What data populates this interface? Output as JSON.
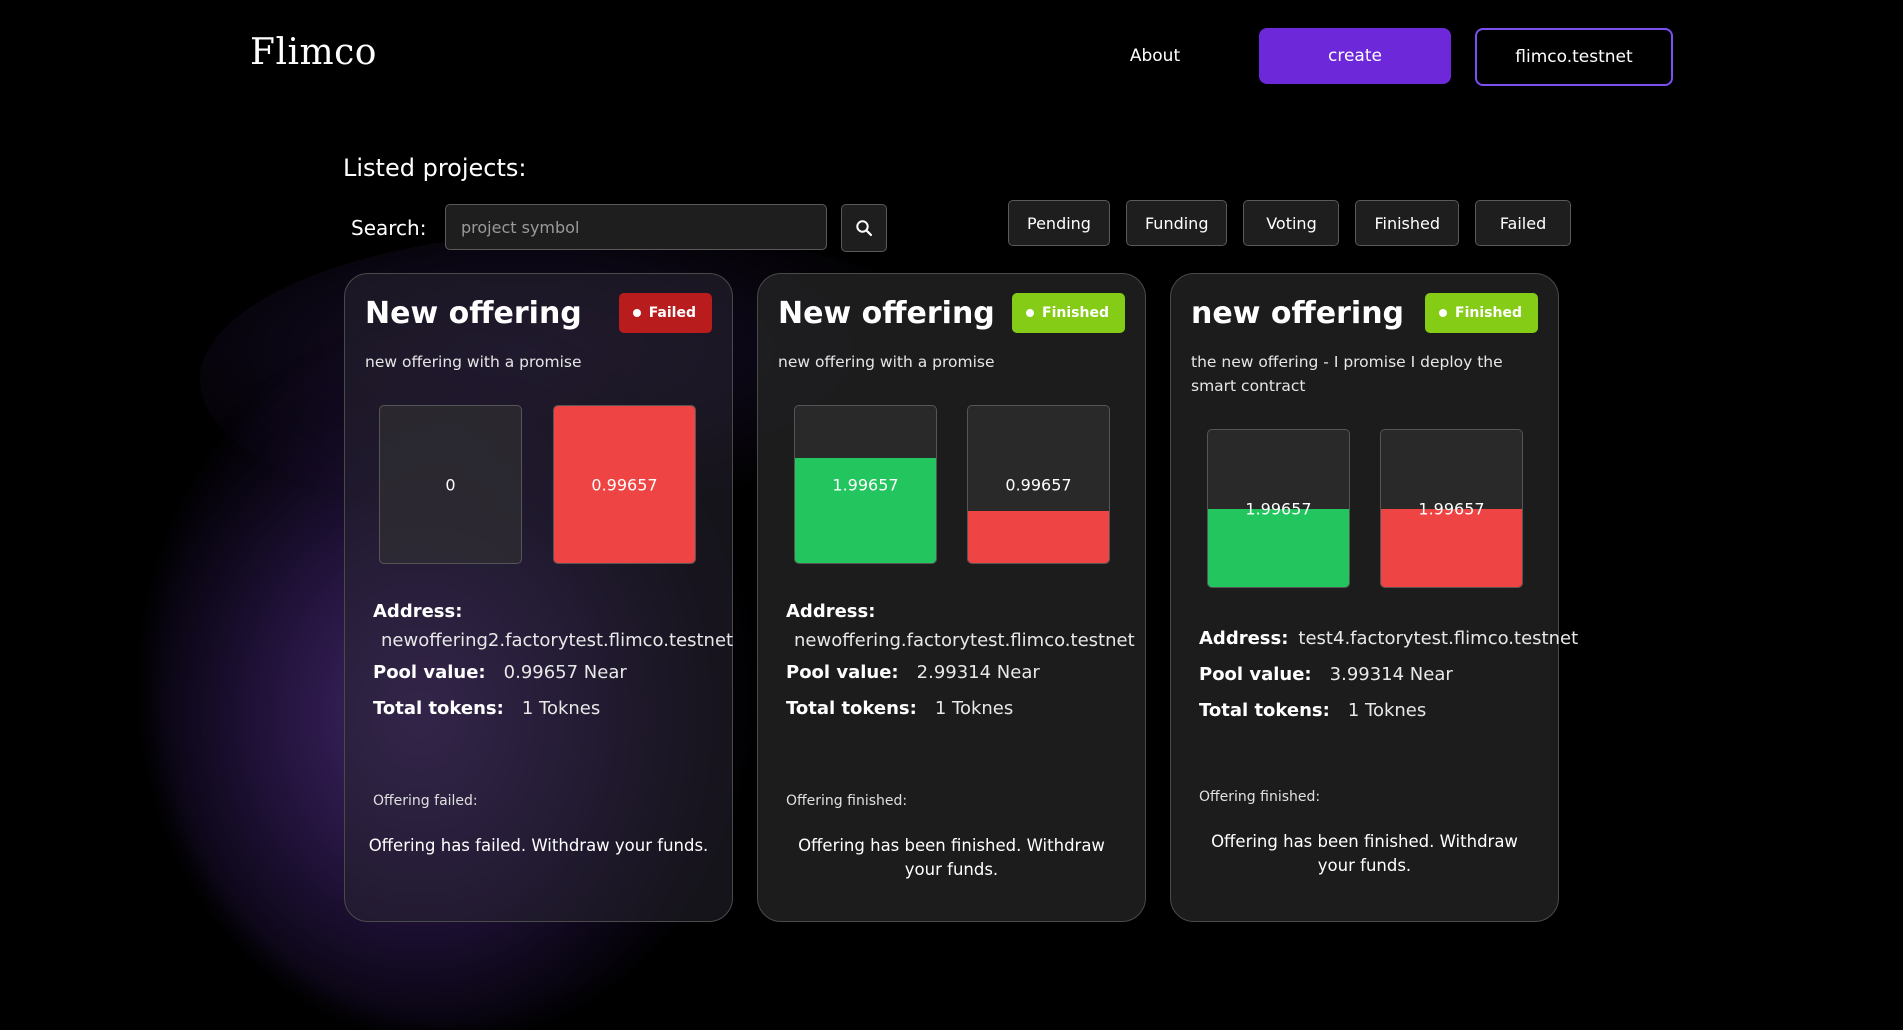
{
  "header": {
    "logo": "Flimco",
    "about": "About",
    "create": "create",
    "account": "flimco.testnet"
  },
  "listing": {
    "title": "Listed projects:",
    "search_label": "Search:",
    "search_placeholder": "project symbol",
    "filters": [
      "Pending",
      "Funding",
      "Voting",
      "Finished",
      "Failed"
    ]
  },
  "colors": {
    "accent": "#6d28d9",
    "failed": "#b91c1c",
    "finished": "#84cc16",
    "yes": "#22c55e",
    "no": "#ef4444"
  },
  "cards": [
    {
      "title": "New offering",
      "status": "Failed",
      "description": "new offering with a promise",
      "bars": [
        {
          "value": "0",
          "fill_fraction": 0.0
        },
        {
          "value": "0.99657",
          "fill_fraction": 1.0
        }
      ],
      "address_label": "Address:",
      "address": "newoffering2.factorytest.flimco.testnet",
      "pool_label": "Pool value:",
      "pool": "0.99657 Near",
      "tokens_label": "Total tokens:",
      "tokens": "1 Toknes",
      "footer_label": "Offering failed:",
      "footer_msg": "Offering has failed. Withdraw your funds."
    },
    {
      "title": "New offering",
      "status": "Finished",
      "description": "new offering with a promise",
      "bars": [
        {
          "value": "1.99657",
          "fill_fraction": 0.67
        },
        {
          "value": "0.99657",
          "fill_fraction": 0.33
        }
      ],
      "address_label": "Address:",
      "address": "newoffering.factorytest.flimco.testnet",
      "pool_label": "Pool value:",
      "pool": "2.99314 Near",
      "tokens_label": "Total tokens:",
      "tokens": "1 Toknes",
      "footer_label": "Offering finished:",
      "footer_msg": "Offering has been finished. Withdraw your funds."
    },
    {
      "title": "new offering",
      "status": "Finished",
      "description": "the new offering - I promise I deploy the smart contract",
      "bars": [
        {
          "value": "1.99657",
          "fill_fraction": 0.5
        },
        {
          "value": "1.99657",
          "fill_fraction": 0.5
        }
      ],
      "address_label": "Address:",
      "address": "test4.factorytest.flimco.testnet",
      "pool_label": "Pool value:",
      "pool": "3.99314 Near",
      "tokens_label": "Total tokens:",
      "tokens": "1 Toknes",
      "footer_label": "Offering finished:",
      "footer_msg": "Offering has been finished. Withdraw your funds."
    }
  ]
}
